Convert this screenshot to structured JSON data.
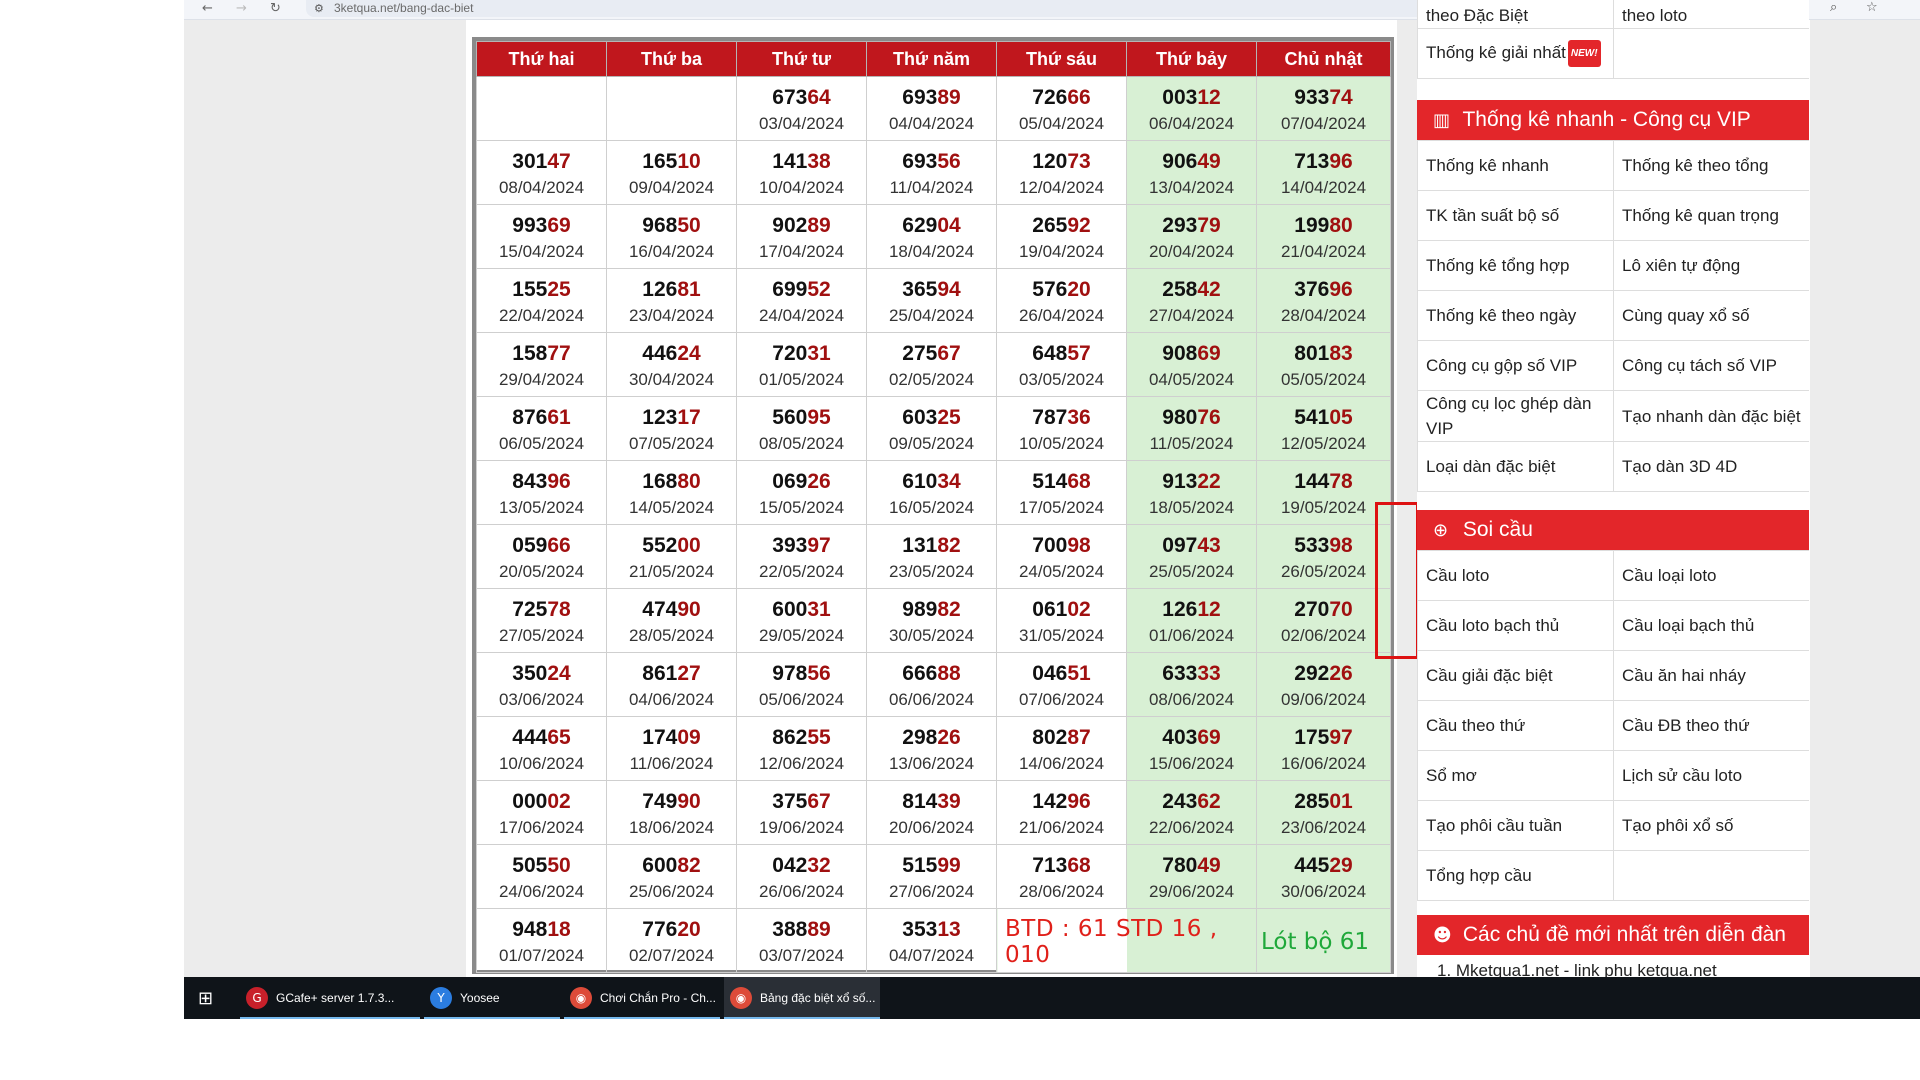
{
  "browser": {
    "back_icon": "back-arrow-icon",
    "forward_icon": "forward-arrow-icon",
    "reload_icon": "reload-icon",
    "url": "3ketqua.net/bang-dac-biet",
    "search_icon": "search-icon",
    "star_icon": "star-icon"
  },
  "table": {
    "headers": [
      "Thứ hai",
      "Thứ ba",
      "Thứ tư",
      "Thứ năm",
      "Thứ sáu",
      "Thứ bảy",
      "Chủ nhật"
    ],
    "rows": [
      [
        null,
        null,
        {
          "a": "673",
          "b": "64",
          "d": "03/04/2024"
        },
        {
          "a": "693",
          "b": "89",
          "d": "04/04/2024"
        },
        {
          "a": "726",
          "b": "66",
          "d": "05/04/2024"
        },
        {
          "a": "003",
          "b": "12",
          "d": "06/04/2024"
        },
        {
          "a": "933",
          "b": "74",
          "d": "07/04/2024"
        }
      ],
      [
        {
          "a": "301",
          "b": "47",
          "d": "08/04/2024"
        },
        {
          "a": "165",
          "b": "10",
          "d": "09/04/2024"
        },
        {
          "a": "141",
          "b": "38",
          "d": "10/04/2024"
        },
        {
          "a": "693",
          "b": "56",
          "d": "11/04/2024"
        },
        {
          "a": "120",
          "b": "73",
          "d": "12/04/2024"
        },
        {
          "a": "906",
          "b": "49",
          "d": "13/04/2024"
        },
        {
          "a": "713",
          "b": "96",
          "d": "14/04/2024"
        }
      ],
      [
        {
          "a": "993",
          "b": "69",
          "d": "15/04/2024"
        },
        {
          "a": "968",
          "b": "50",
          "d": "16/04/2024"
        },
        {
          "a": "902",
          "b": "89",
          "d": "17/04/2024"
        },
        {
          "a": "629",
          "b": "04",
          "d": "18/04/2024"
        },
        {
          "a": "265",
          "b": "92",
          "d": "19/04/2024"
        },
        {
          "a": "293",
          "b": "79",
          "d": "20/04/2024"
        },
        {
          "a": "199",
          "b": "80",
          "d": "21/04/2024"
        }
      ],
      [
        {
          "a": "155",
          "b": "25",
          "d": "22/04/2024"
        },
        {
          "a": "126",
          "b": "81",
          "d": "23/04/2024"
        },
        {
          "a": "699",
          "b": "52",
          "d": "24/04/2024"
        },
        {
          "a": "365",
          "b": "94",
          "d": "25/04/2024"
        },
        {
          "a": "576",
          "b": "20",
          "d": "26/04/2024"
        },
        {
          "a": "258",
          "b": "42",
          "d": "27/04/2024"
        },
        {
          "a": "376",
          "b": "96",
          "d": "28/04/2024"
        }
      ],
      [
        {
          "a": "158",
          "b": "77",
          "d": "29/04/2024"
        },
        {
          "a": "446",
          "b": "24",
          "d": "30/04/2024"
        },
        {
          "a": "720",
          "b": "31",
          "d": "01/05/2024"
        },
        {
          "a": "275",
          "b": "67",
          "d": "02/05/2024"
        },
        {
          "a": "648",
          "b": "57",
          "d": "03/05/2024"
        },
        {
          "a": "908",
          "b": "69",
          "d": "04/05/2024"
        },
        {
          "a": "801",
          "b": "83",
          "d": "05/05/2024"
        }
      ],
      [
        {
          "a": "876",
          "b": "61",
          "d": "06/05/2024"
        },
        {
          "a": "123",
          "b": "17",
          "d": "07/05/2024"
        },
        {
          "a": "560",
          "b": "95",
          "d": "08/05/2024"
        },
        {
          "a": "603",
          "b": "25",
          "d": "09/05/2024"
        },
        {
          "a": "787",
          "b": "36",
          "d": "10/05/2024"
        },
        {
          "a": "980",
          "b": "76",
          "d": "11/05/2024"
        },
        {
          "a": "541",
          "b": "05",
          "d": "12/05/2024"
        }
      ],
      [
        {
          "a": "843",
          "b": "96",
          "d": "13/05/2024"
        },
        {
          "a": "168",
          "b": "80",
          "d": "14/05/2024"
        },
        {
          "a": "069",
          "b": "26",
          "d": "15/05/2024"
        },
        {
          "a": "610",
          "b": "34",
          "d": "16/05/2024"
        },
        {
          "a": "514",
          "b": "68",
          "d": "17/05/2024"
        },
        {
          "a": "913",
          "b": "22",
          "d": "18/05/2024"
        },
        {
          "a": "144",
          "b": "78",
          "d": "19/05/2024"
        }
      ],
      [
        {
          "a": "059",
          "b": "66",
          "d": "20/05/2024"
        },
        {
          "a": "552",
          "b": "00",
          "d": "21/05/2024"
        },
        {
          "a": "393",
          "b": "97",
          "d": "22/05/2024"
        },
        {
          "a": "131",
          "b": "82",
          "d": "23/05/2024"
        },
        {
          "a": "700",
          "b": "98",
          "d": "24/05/2024"
        },
        {
          "a": "097",
          "b": "43",
          "d": "25/05/2024"
        },
        {
          "a": "533",
          "b": "98",
          "d": "26/05/2024"
        }
      ],
      [
        {
          "a": "725",
          "b": "78",
          "d": "27/05/2024"
        },
        {
          "a": "474",
          "b": "90",
          "d": "28/05/2024"
        },
        {
          "a": "600",
          "b": "31",
          "d": "29/05/2024"
        },
        {
          "a": "989",
          "b": "82",
          "d": "30/05/2024"
        },
        {
          "a": "061",
          "b": "02",
          "d": "31/05/2024"
        },
        {
          "a": "126",
          "b": "12",
          "d": "01/06/2024"
        },
        {
          "a": "270",
          "b": "70",
          "d": "02/06/2024"
        }
      ],
      [
        {
          "a": "350",
          "b": "24",
          "d": "03/06/2024"
        },
        {
          "a": "861",
          "b": "27",
          "d": "04/06/2024"
        },
        {
          "a": "978",
          "b": "56",
          "d": "05/06/2024"
        },
        {
          "a": "666",
          "b": "88",
          "d": "06/06/2024"
        },
        {
          "a": "046",
          "b": "51",
          "d": "07/06/2024"
        },
        {
          "a": "633",
          "b": "33",
          "d": "08/06/2024"
        },
        {
          "a": "292",
          "b": "26",
          "d": "09/06/2024"
        }
      ],
      [
        {
          "a": "444",
          "b": "65",
          "d": "10/06/2024"
        },
        {
          "a": "174",
          "b": "09",
          "d": "11/06/2024"
        },
        {
          "a": "862",
          "b": "55",
          "d": "12/06/2024"
        },
        {
          "a": "298",
          "b": "26",
          "d": "13/06/2024"
        },
        {
          "a": "802",
          "b": "87",
          "d": "14/06/2024"
        },
        {
          "a": "403",
          "b": "69",
          "d": "15/06/2024"
        },
        {
          "a": "175",
          "b": "97",
          "d": "16/06/2024"
        }
      ],
      [
        {
          "a": "000",
          "b": "02",
          "d": "17/06/2024"
        },
        {
          "a": "749",
          "b": "90",
          "d": "18/06/2024"
        },
        {
          "a": "375",
          "b": "67",
          "d": "19/06/2024"
        },
        {
          "a": "814",
          "b": "39",
          "d": "20/06/2024"
        },
        {
          "a": "142",
          "b": "96",
          "d": "21/06/2024"
        },
        {
          "a": "243",
          "b": "62",
          "d": "22/06/2024"
        },
        {
          "a": "285",
          "b": "01",
          "d": "23/06/2024"
        }
      ],
      [
        {
          "a": "505",
          "b": "50",
          "d": "24/06/2024"
        },
        {
          "a": "600",
          "b": "82",
          "d": "25/06/2024"
        },
        {
          "a": "042",
          "b": "32",
          "d": "26/06/2024"
        },
        {
          "a": "515",
          "b": "99",
          "d": "27/06/2024"
        },
        {
          "a": "713",
          "b": "68",
          "d": "28/06/2024"
        },
        {
          "a": "780",
          "b": "49",
          "d": "29/06/2024"
        },
        {
          "a": "445",
          "b": "29",
          "d": "30/06/2024"
        }
      ],
      [
        {
          "a": "948",
          "b": "18",
          "d": "01/07/2024"
        },
        {
          "a": "776",
          "b": "20",
          "d": "02/07/2024"
        },
        {
          "a": "388",
          "b": "89",
          "d": "03/07/2024"
        },
        {
          "a": "353",
          "b": "13",
          "d": "04/07/2024"
        },
        null,
        null,
        null
      ]
    ],
    "note_red": "BTD : 61 STD 16 , 010",
    "note_green": "Lót bộ 61"
  },
  "sidebar": {
    "top_rows": [
      [
        "theo Đặc Biệt",
        "theo loto"
      ]
    ],
    "special_row": {
      "label": "Thống kê giải nhất",
      "badge": "NEW!"
    },
    "section1": {
      "title": "Thống kê nhanh - Công cụ VIP",
      "icon": "bar-chart-icon",
      "items": [
        [
          "Thống kê nhanh",
          "Thống kê theo tổng"
        ],
        [
          "TK tần suất bộ số",
          "Thống kê quan trọng"
        ],
        [
          "Thống kê tổng hợp",
          "Lô xiên tự động"
        ],
        [
          "Thống kê theo ngày",
          "Cùng quay xổ số"
        ],
        [
          "Công cụ gộp số VIP",
          "Công cụ tách số VIP"
        ],
        [
          "Công cụ lọc ghép dàn VIP",
          "Tạo nhanh dàn đặc biệt"
        ],
        [
          "Loại dàn đặc biệt",
          "Tạo dàn 3D 4D"
        ]
      ]
    },
    "section2": {
      "title": "Soi cầu",
      "icon": "search-plus-icon",
      "items": [
        [
          "Cầu loto",
          "Cầu loại loto"
        ],
        [
          "Cầu loto bạch thủ",
          "Cầu loại bạch thủ"
        ],
        [
          "Cầu giải đặc biệt",
          "Cầu ăn hai nháy"
        ],
        [
          "Cầu theo thứ",
          "Cầu ĐB theo thứ"
        ],
        [
          "Sổ mơ",
          "Lịch sử cầu loto"
        ],
        [
          "Tạo phôi cầu tuần",
          "Tạo phôi xổ số"
        ],
        [
          "Tổng hợp cầu",
          ""
        ]
      ]
    },
    "section3": {
      "title": "Các chủ đề mới nhất trên diễn đàn",
      "icon": "users-icon",
      "first_item": "1. Mketqua1.net - link phụ ketqua.net"
    }
  },
  "taskbar": {
    "start_icon": "windows-start-icon",
    "items": [
      {
        "label": "GCafe+ server 1.7.3...",
        "icon": "gcafe-icon",
        "color": "#c8202a"
      },
      {
        "label": "Yoosee",
        "icon": "yoosee-icon",
        "color": "#2b7de0"
      },
      {
        "label": "Chơi Chắn Pro - Ch...",
        "icon": "chrome-icon",
        "color": "#dd4b39"
      },
      {
        "label": "Bảng đặc biệt xổ số...",
        "icon": "chrome-icon",
        "color": "#dd4b39"
      }
    ]
  },
  "colors": {
    "header_red": "#c0171d",
    "number_red": "#a01010",
    "weekend_green": "#d8f0d4",
    "sidebar_red": "#e3262a"
  }
}
